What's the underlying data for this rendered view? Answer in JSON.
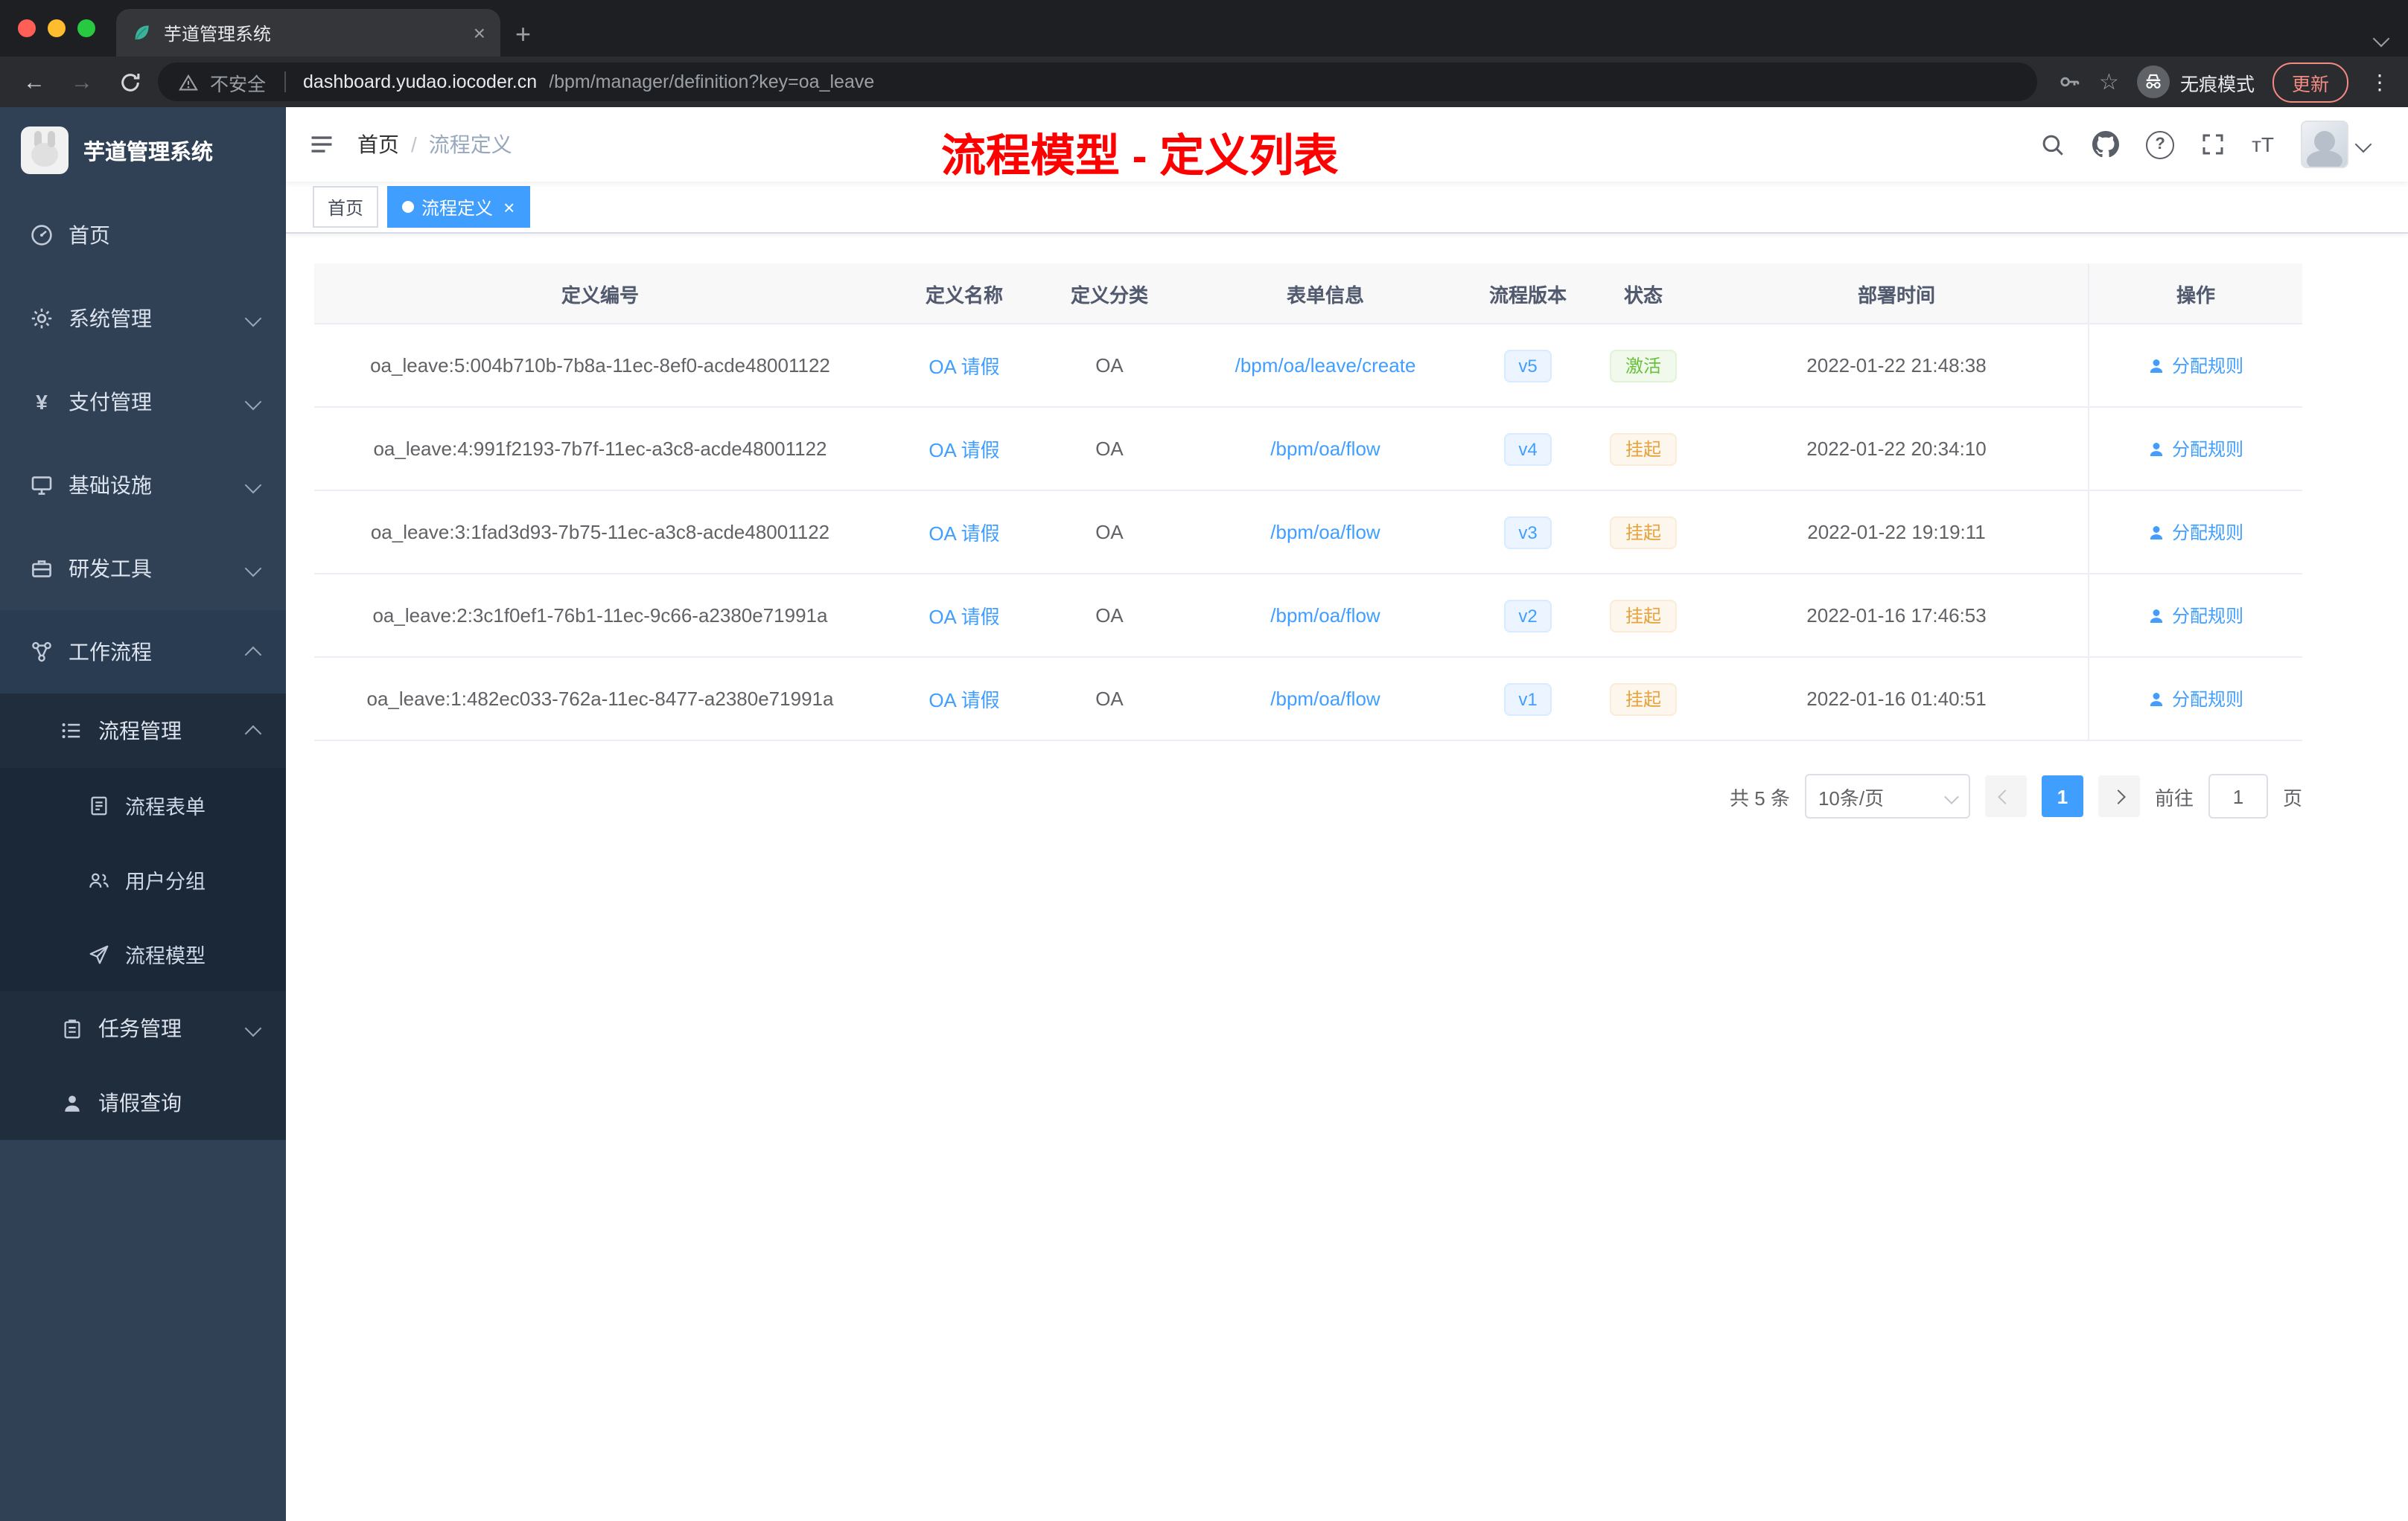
{
  "browser": {
    "tab_title": "芋道管理系统",
    "security_label": "不安全",
    "url_domain": "dashboard.yudao.iocoder.cn",
    "url_path": "/bpm/manager/definition?key=oa_leave",
    "incognito_label": "无痕模式",
    "update_label": "更新"
  },
  "glyphs": {
    "close": "×",
    "plus": "+",
    "kebab": "⋮",
    "star": "☆",
    "back": "←",
    "forward": "→",
    "text_size": "тT",
    "question": "?"
  },
  "sidebar": {
    "app_title": "芋道管理系统",
    "items": [
      {
        "label": "首页"
      },
      {
        "label": "系统管理"
      },
      {
        "label": "支付管理"
      },
      {
        "label": "基础设施"
      },
      {
        "label": "研发工具"
      },
      {
        "label": "工作流程"
      },
      {
        "label": "流程管理"
      },
      {
        "label": "流程表单"
      },
      {
        "label": "用户分组"
      },
      {
        "label": "流程模型"
      },
      {
        "label": "任务管理"
      },
      {
        "label": "请假查询"
      }
    ]
  },
  "header": {
    "breadcrumb_home": "首页",
    "breadcrumb_separator": "/",
    "breadcrumb_current": "流程定义",
    "annotation": "流程模型 - 定义列表"
  },
  "tags": {
    "home": "首页",
    "current": "流程定义"
  },
  "table": {
    "columns": [
      "定义编号",
      "定义名称",
      "定义分类",
      "表单信息",
      "流程版本",
      "状态",
      "部署时间",
      "操作"
    ],
    "rows": [
      {
        "id": "oa_leave:5:004b710b-7b8a-11ec-8ef0-acde48001122",
        "name": "OA 请假",
        "category": "OA",
        "form": "/bpm/oa/leave/create",
        "version": "v5",
        "status": "激活",
        "time": "2022-01-22 21:48:38",
        "action": "分配规则"
      },
      {
        "id": "oa_leave:4:991f2193-7b7f-11ec-a3c8-acde48001122",
        "name": "OA 请假",
        "category": "OA",
        "form": "/bpm/oa/flow",
        "version": "v4",
        "status": "挂起",
        "time": "2022-01-22 20:34:10",
        "action": "分配规则"
      },
      {
        "id": "oa_leave:3:1fad3d93-7b75-11ec-a3c8-acde48001122",
        "name": "OA 请假",
        "category": "OA",
        "form": "/bpm/oa/flow",
        "version": "v3",
        "status": "挂起",
        "time": "2022-01-22 19:19:11",
        "action": "分配规则"
      },
      {
        "id": "oa_leave:2:3c1f0ef1-76b1-11ec-9c66-a2380e71991a",
        "name": "OA 请假",
        "category": "OA",
        "form": "/bpm/oa/flow",
        "version": "v2",
        "status": "挂起",
        "time": "2022-01-16 17:46:53",
        "action": "分配规则"
      },
      {
        "id": "oa_leave:1:482ec033-762a-11ec-8477-a2380e71991a",
        "name": "OA 请假",
        "category": "OA",
        "form": "/bpm/oa/flow",
        "version": "v1",
        "status": "挂起",
        "time": "2022-01-16 01:40:51",
        "action": "分配规则"
      }
    ]
  },
  "pagination": {
    "total": "共 5 条",
    "page_size": "10条/页",
    "page": "1",
    "goto_label": "前往",
    "goto_value": "1",
    "unit_label": "页"
  },
  "colors": {
    "accent_blue": "#409eff",
    "success_green": "#67c23a",
    "warning_orange": "#e6a23c",
    "annotation_red": "#fe0000",
    "sidebar_bg": "#304156",
    "submenu_bg": "#1f2d3d",
    "update_red": "#f28b82"
  }
}
